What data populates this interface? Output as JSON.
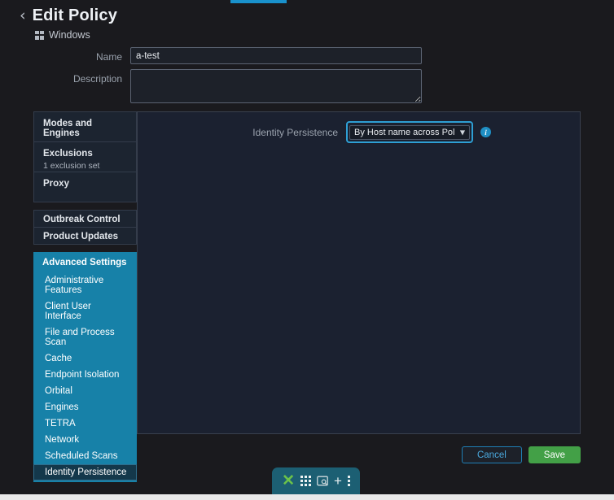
{
  "header": {
    "back_icon": "chevron-left-icon",
    "title": "Edit Policy",
    "platform": "Windows",
    "platform_icon": "windows-logo-icon"
  },
  "form": {
    "name_label": "Name",
    "name_value": "a-test",
    "name_placeholder": "",
    "description_label": "Description",
    "description_value": "",
    "description_placeholder": ""
  },
  "sidebar": {
    "cards": [
      {
        "title": "Modes and Engines",
        "subtitle": ""
      },
      {
        "title": "Exclusions",
        "subtitle": "1 exclusion set"
      },
      {
        "title": "Proxy",
        "subtitle": ""
      },
      {
        "title": "Outbreak Control",
        "subtitle": ""
      },
      {
        "title": "Product Updates",
        "subtitle": ""
      }
    ],
    "advanced_title": "Advanced Settings",
    "advanced_items": [
      "Administrative Features",
      "Client User Interface",
      "File and Process Scan",
      "Cache",
      "Endpoint Isolation",
      "Orbital",
      "Engines",
      "TETRA",
      "Network",
      "Scheduled Scans",
      "Identity Persistence"
    ],
    "active_item": "Identity Persistence"
  },
  "main": {
    "identity_persistence_label": "Identity Persistence",
    "identity_persistence_value": "By Host name across Policy",
    "identity_persistence_options": [
      "By Host name across Policy"
    ],
    "select_chevron_icon": "chevron-down-icon",
    "info_icon": "info-circle-icon",
    "info_icon_glyph": "i"
  },
  "footer": {
    "cancel_label": "Cancel",
    "save_label": "Save"
  },
  "taskbar": {
    "items": [
      {
        "icon": "xfce-x-icon",
        "glyph": "✕"
      },
      {
        "icon": "app-grid-icon",
        "glyph": ""
      },
      {
        "icon": "screenshot-icon",
        "glyph": ""
      },
      {
        "icon": "plus-icon",
        "glyph": "+"
      },
      {
        "icon": "more-vertical-icon",
        "glyph": ""
      }
    ]
  },
  "colors": {
    "background": "#1a1a1e",
    "accent_blue": "#1781a8",
    "focus_ring": "#2e9fd4",
    "save_green": "#43a047",
    "cancel_blue": "#4aa8dd",
    "active_item": "#14384b",
    "panel": "#1b2130"
  }
}
